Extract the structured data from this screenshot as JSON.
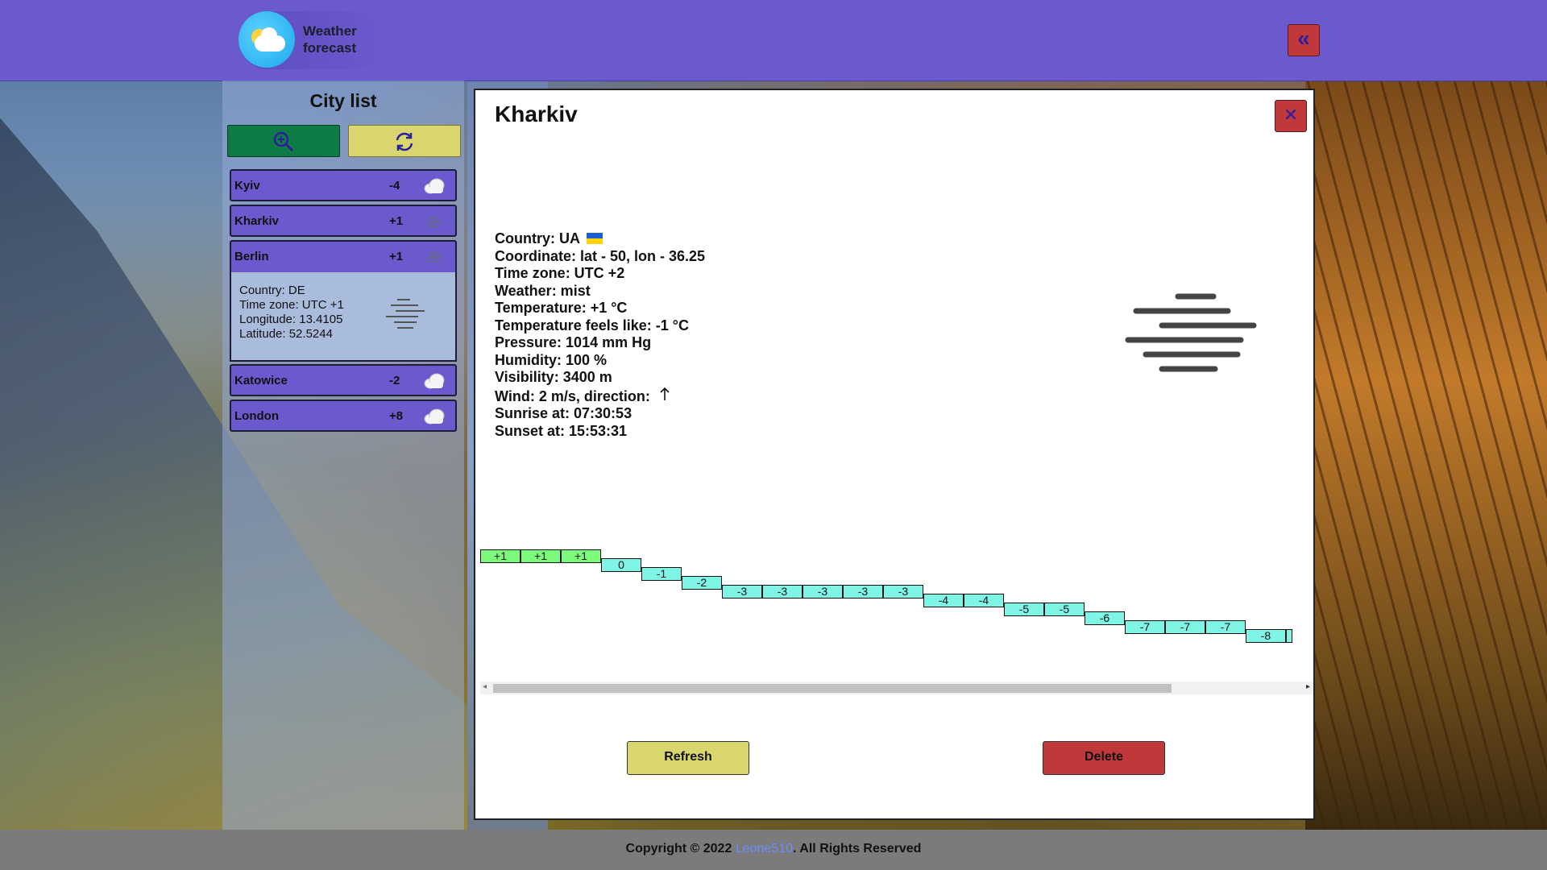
{
  "header": {
    "logo_text": "Weather forecast",
    "collapse_label": "«"
  },
  "sidebar": {
    "title": "City list",
    "search_icon": "zoom-in-icon",
    "sync_icon": "sync-icon",
    "cities": [
      {
        "name": "Kyiv",
        "temp": "-4",
        "icon": "cloud-icon"
      },
      {
        "name": "Kharkiv",
        "temp": "+1",
        "icon": "mist-icon"
      },
      {
        "name": "Berlin",
        "temp": "+1",
        "icon": "mist-icon"
      },
      {
        "name": "Katowice",
        "temp": "-2",
        "icon": "cloud-icon"
      },
      {
        "name": "London",
        "temp": "+8",
        "icon": "cloud-icon"
      }
    ],
    "details": {
      "country": "Country: DE",
      "timezone": "Time zone: UTC +1",
      "longitude": "Longitude: 13.4105",
      "latitude": "Latitude: 52.5244"
    }
  },
  "modal": {
    "title": "Kharkiv",
    "close_label": "✕",
    "info": {
      "country": "Country: UA",
      "coordinate": "Coordinate: lat - 50, lon - 36.25",
      "timezone": "Time zone: UTC +2",
      "weather": "Weather: mist",
      "temperature": "Temperature: +1 °C",
      "feels_like": "Temperature feels like: -1 °C",
      "pressure": "Pressure: 1014 mm Hg",
      "humidity": "Humidity: 100 %",
      "visibility": "Visibility: 3400 m",
      "wind": "Wind: 2 m/s, direction:",
      "sunrise": "Sunrise at: 07:30:53",
      "sunset": "Sunset at: 15:53:31"
    },
    "forecast": [
      "+1",
      "+1",
      "+1",
      "0",
      "-1",
      "-2",
      "-3",
      "-3",
      "-3",
      "-3",
      "-3",
      "-4",
      "-4",
      "-5",
      "-5",
      "-6",
      "-7",
      "-7",
      "-7",
      "-8",
      ""
    ],
    "refresh_label": "Refresh",
    "delete_label": "Delete"
  },
  "footer": {
    "copyright": "Copyright © 2022",
    "author": "Leone510",
    "rights": ". All Rights Reserved"
  },
  "colors": {
    "header": "#6b5acd",
    "forecast_positive": "#7cfa7c",
    "forecast_negative": "#7ff5e6",
    "refresh": "#d9d66e",
    "delete": "#c0383a"
  }
}
